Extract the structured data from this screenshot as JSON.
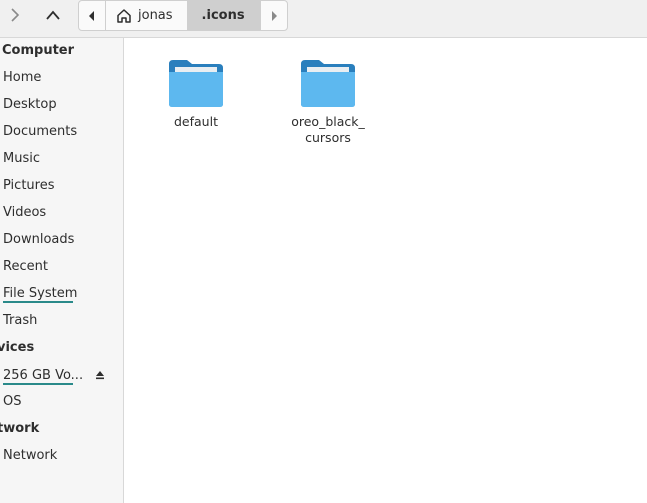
{
  "toolbar": {
    "path": {
      "crumbs": [
        {
          "label": "jonas"
        },
        {
          "label": ".icons"
        }
      ]
    }
  },
  "sidebar": {
    "sections": [
      {
        "header": "Computer",
        "items": [
          "Home",
          "Desktop",
          "Documents",
          "Music",
          "Pictures",
          "Videos",
          "Downloads",
          "Recent",
          "File System",
          "Trash"
        ]
      },
      {
        "header": "vices",
        "items": [
          "256 GB Vo...",
          "OS"
        ]
      },
      {
        "header": "twork",
        "items": [
          "Network"
        ]
      }
    ]
  },
  "main": {
    "files": [
      {
        "name": "default",
        "type": "folder"
      },
      {
        "name": "oreo_black_\ncursors",
        "type": "folder"
      }
    ]
  },
  "colors": {
    "folder_front": "#5db8ef",
    "folder_back": "#2a7fbd",
    "accent_underline": "#2a8a8a"
  }
}
